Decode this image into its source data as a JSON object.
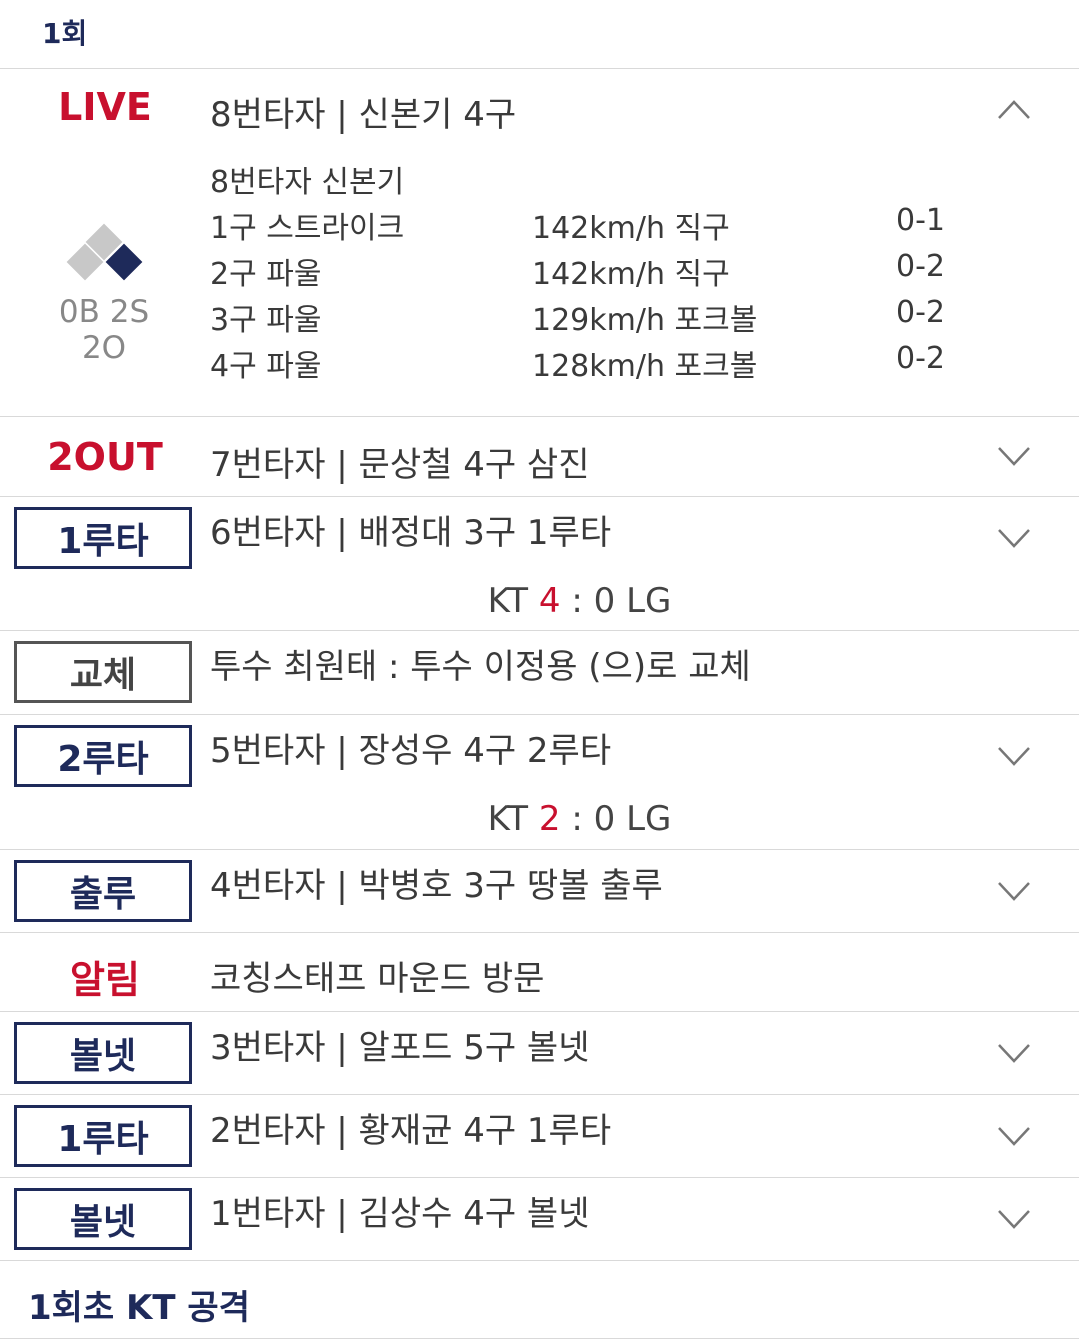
{
  "inning": {
    "title": "1회"
  },
  "colors": {
    "accent_red": "#c8102e",
    "navy": "#1e2a5a",
    "base_empty": "#c8c8c8",
    "base_occupied": "#1e2a5a"
  },
  "live": {
    "label": "LIVE",
    "title": "8번타자 | 신본기 4구",
    "count": "0B 2S 2O",
    "bases": {
      "first": true,
      "second": false,
      "third": false
    },
    "batter": "8번타자 신본기",
    "pitches": [
      {
        "pitch": "1구 스트라이크",
        "speed": "142km/h 직구",
        "count": "0-1"
      },
      {
        "pitch": "2구 파울",
        "speed": "142km/h 직구",
        "count": "0-2"
      },
      {
        "pitch": "3구 파울",
        "speed": "129km/h 포크볼",
        "count": "0-2"
      },
      {
        "pitch": "4구 파울",
        "speed": "128km/h 포크볼",
        "count": "0-2"
      }
    ]
  },
  "events": [
    {
      "label": "2OUT",
      "title": "7번타자 | 문상철 4구 삼진"
    },
    {
      "label": "1루타",
      "title": "6번타자 | 배정대 3구 1루타",
      "score": {
        "home": "KT",
        "home_score": "4",
        "sep": " : ",
        "away_score": "0",
        "away": "LG"
      }
    },
    {
      "label": "교체",
      "title": "투수 최원태 : 투수 이정용 (으)로 교체"
    },
    {
      "label": "2루타",
      "title": "5번타자 | 장성우 4구 2루타",
      "score": {
        "home": "KT",
        "home_score": "2",
        "sep": " : ",
        "away_score": "0",
        "away": "LG"
      }
    },
    {
      "label": "출루",
      "title": "4번타자 | 박병호 3구 땅볼 출루"
    },
    {
      "label": "알림",
      "title": "코칭스태프 마운드 방문"
    },
    {
      "label": "볼넷",
      "title": "3번타자 | 알포드 5구 볼넷"
    },
    {
      "label": "1루타",
      "title": "2번타자 | 황재균 4구 1루타"
    },
    {
      "label": "볼넷",
      "title": "1번타자 | 김상수 4구 볼넷"
    }
  ],
  "footer": {
    "title": "1회초 KT 공격"
  }
}
